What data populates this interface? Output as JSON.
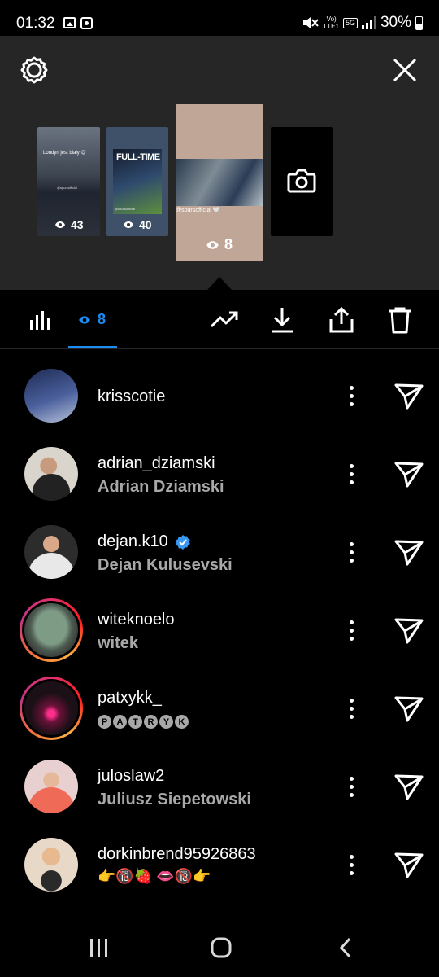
{
  "status_bar": {
    "time": "01:32",
    "volte_top": "Vo)",
    "volte_bottom": "LTE1",
    "network": "5G",
    "battery": "30%",
    "left_icons": [
      "gallery-icon",
      "camera-notification-icon"
    ],
    "right_icons": [
      "mute-icon",
      "volte-icon",
      "5g-icon",
      "signal-icon",
      "battery-icon"
    ]
  },
  "header": {
    "settings_icon": "gear-icon",
    "close_icon": "close-icon"
  },
  "stories": [
    {
      "caption": "Londyn jest biały 😊",
      "tag": "@spursofficial",
      "views": "43"
    },
    {
      "caption": "FULL-TIME",
      "tag": "@spursofficial",
      "views": "40"
    },
    {
      "caption": "",
      "tag": "@spursofficial 🤍",
      "views": "8",
      "selected": true
    },
    {
      "caption": "",
      "tag": "",
      "views": "",
      "icon": "camera-icon"
    }
  ],
  "toolbar": {
    "insights_icon": "bar-chart-icon",
    "viewers_count": "8",
    "viewers_icon": "eye-icon",
    "actions": [
      "promote-trend-icon",
      "download-icon",
      "share-icon",
      "delete-icon"
    ]
  },
  "viewers": [
    {
      "username": "krisscotie",
      "full_name": "",
      "verified": false,
      "ring": false,
      "avatar_colors": [
        "#1d2a52",
        "#4a5f9c"
      ]
    },
    {
      "username": "adrian_dziamski",
      "full_name": "Adrian Dziamski",
      "verified": false,
      "ring": false,
      "avatar_colors": [
        "#d9d4cc",
        "#222222"
      ]
    },
    {
      "username": "dejan.k10",
      "full_name": "Dejan Kulusevski",
      "verified": true,
      "ring": false,
      "avatar_colors": [
        "#2c2c2c",
        "#e8e8e8"
      ]
    },
    {
      "username": "witeknoelo",
      "full_name": "witek",
      "verified": false,
      "ring": true,
      "avatar_colors": [
        "#7d9b85",
        "#3b3b3b"
      ]
    },
    {
      "username": "patxykk_",
      "full_name": "",
      "letters": [
        "P",
        "A",
        "T",
        "R",
        "Y",
        "K"
      ],
      "verified": false,
      "ring": true,
      "avatar_colors": [
        "#1a1016",
        "#ff2f8e"
      ]
    },
    {
      "username": "juloslaw2",
      "full_name": "Juliusz Siepetowski",
      "verified": false,
      "ring": false,
      "avatar_colors": [
        "#e8cfd0",
        "#f06b57"
      ]
    },
    {
      "username": "dorkinbrend95926863",
      "full_name": "",
      "emoji_line": "👉🔞🍓 👄🔞👉",
      "verified": false,
      "ring": false,
      "avatar_colors": [
        "#e7d8c8",
        "#2a2a2a"
      ]
    }
  ],
  "row_actions": {
    "more_icon": "more-vertical-icon",
    "send_icon": "send-icon"
  },
  "nav_bar": {
    "recents_icon": "recents-icon",
    "home_icon": "home-icon",
    "back_icon": "back-icon"
  }
}
